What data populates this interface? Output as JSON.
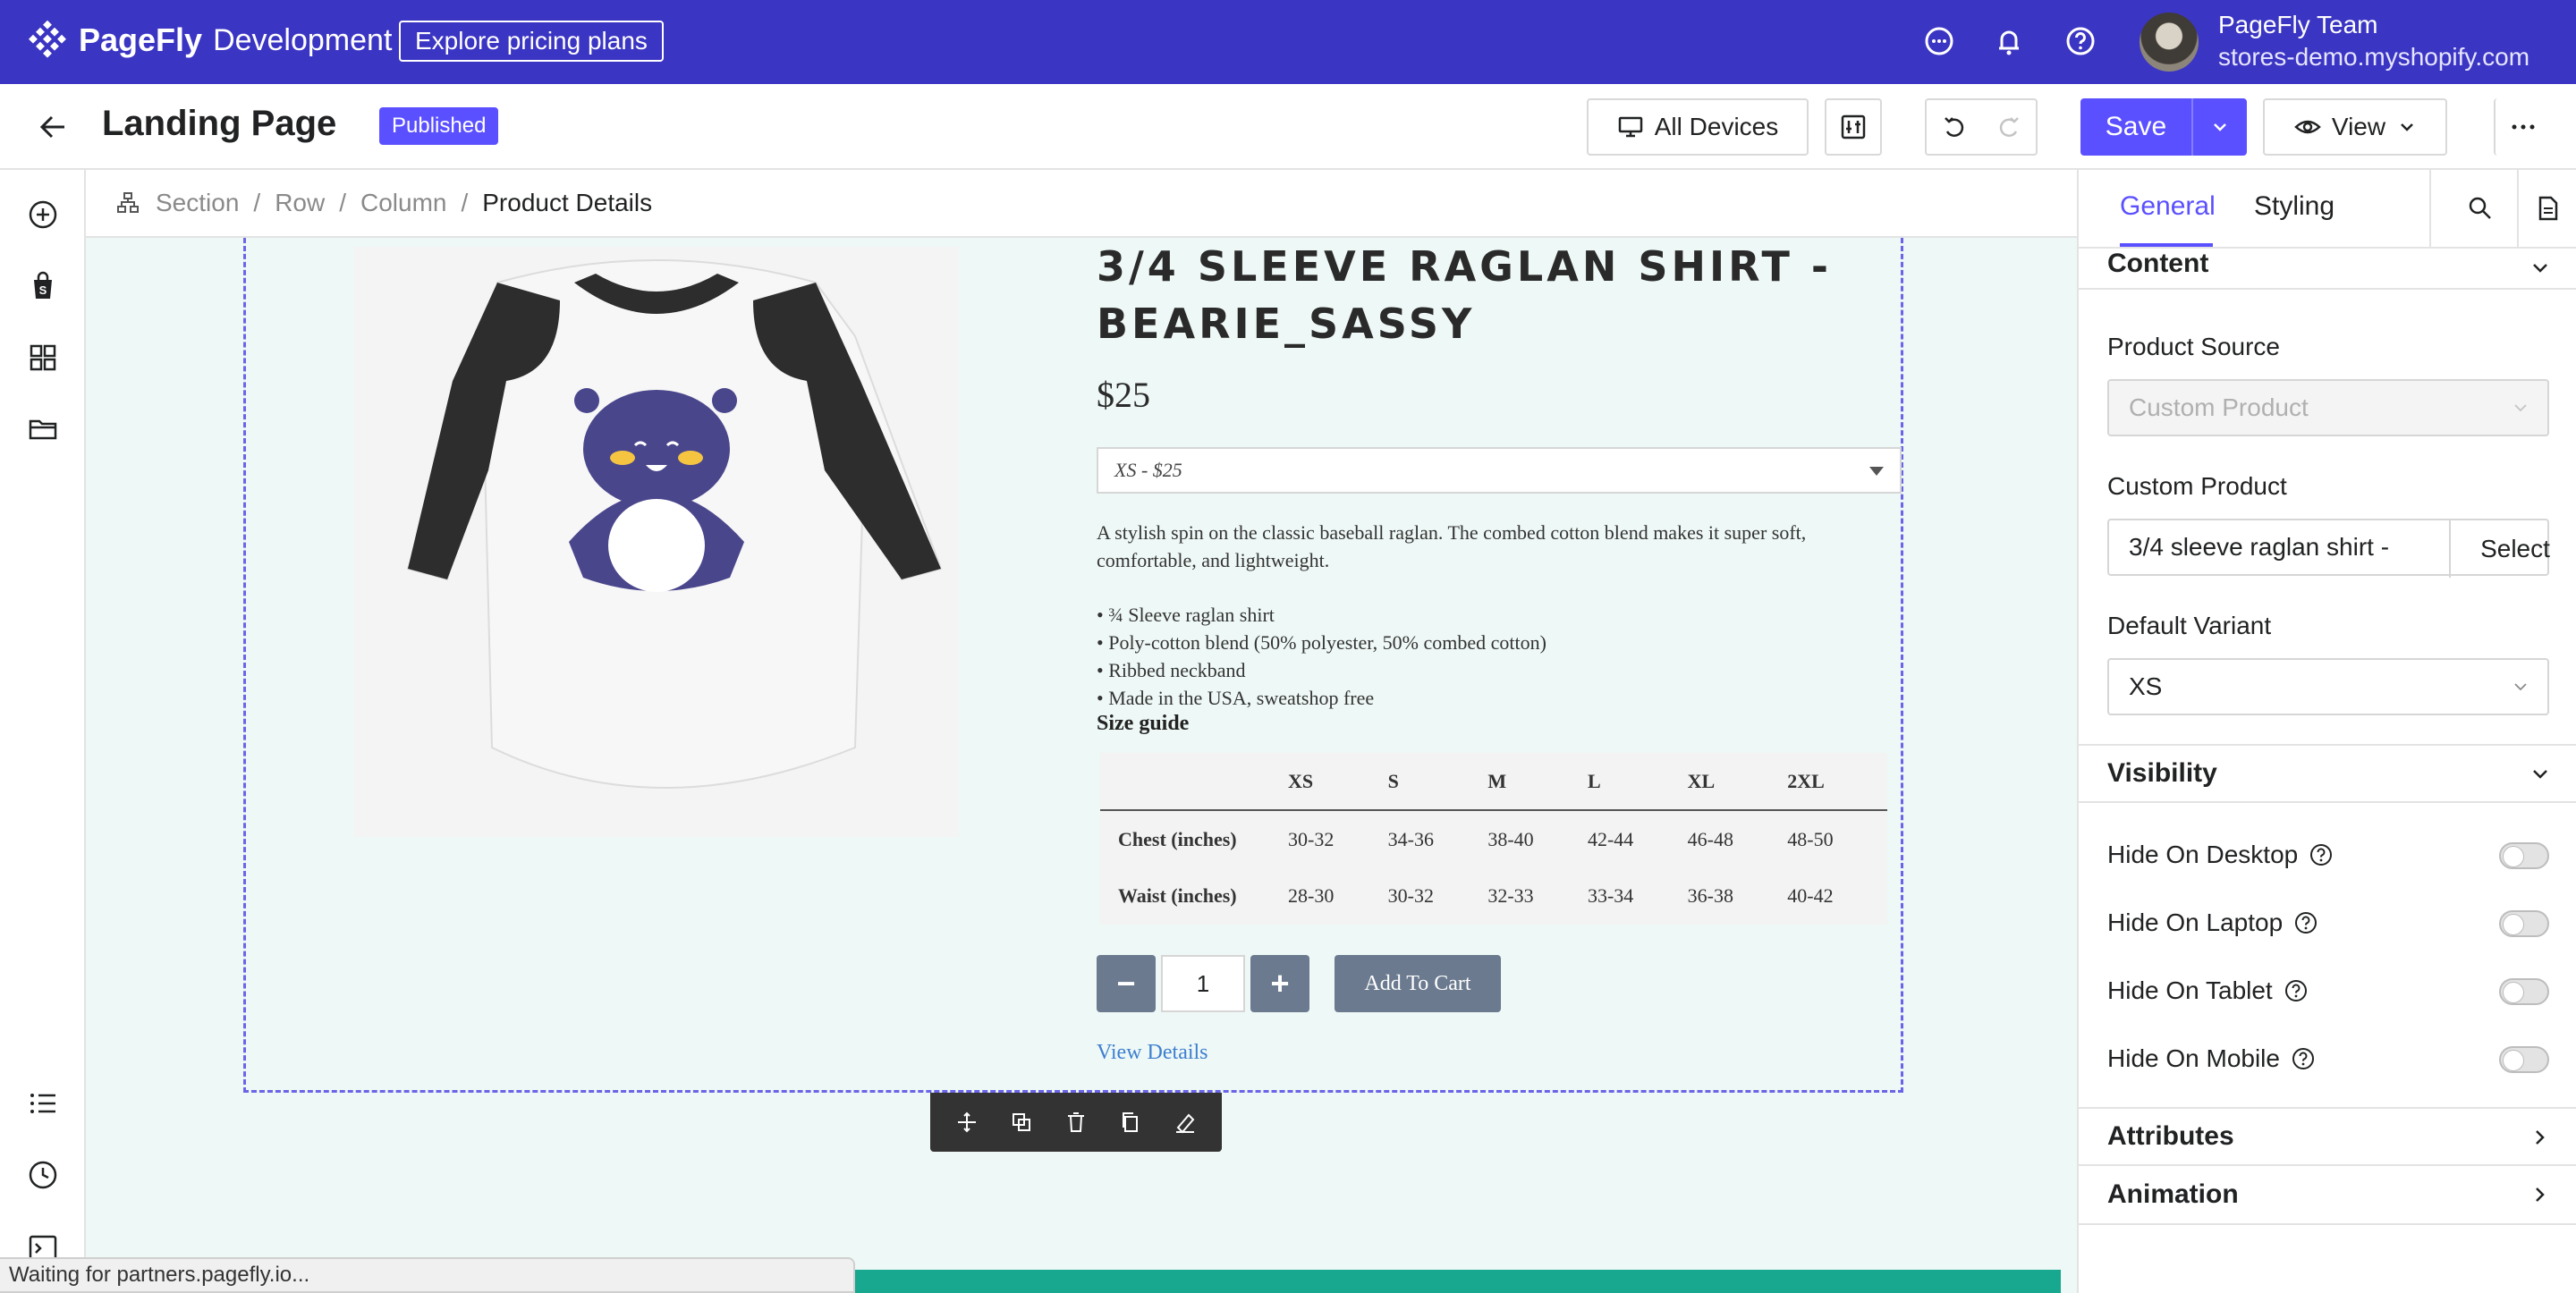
{
  "app": {
    "brand": "PageFly",
    "env": "Development",
    "pricing_button": "Explore pricing plans",
    "user_name": "PageFly Team",
    "user_store": "stores-demo.myshopify.com"
  },
  "header": {
    "title": "Landing Page",
    "badge": "Published",
    "devices_label": "All Devices",
    "save_label": "Save",
    "view_label": "View"
  },
  "breadcrumb": {
    "items": [
      "Section",
      "Row",
      "Column"
    ],
    "current": "Product Details"
  },
  "product": {
    "title": "3/4 SLEEVE RAGLAN SHIRT - BEARIE_SASSY",
    "price": "$25",
    "variant": "XS - $25",
    "description": "A stylish spin on the classic baseball raglan. The combed cotton blend makes it super soft, comfortable, and lightweight.",
    "bullets": [
      "• ¾ Sleeve raglan shirt",
      "• Poly-cotton blend (50% polyester, 50% combed cotton)",
      "• Ribbed neckband",
      "• Made in the USA, sweatshop free"
    ],
    "size_guide_label": "Size guide",
    "size_table": {
      "headers": [
        "",
        "XS",
        "S",
        "M",
        "L",
        "XL",
        "2XL"
      ],
      "rows": [
        [
          "Chest (inches)",
          "30-32",
          "34-36",
          "38-40",
          "42-44",
          "46-48",
          "48-50"
        ],
        [
          "Waist (inches)",
          "28-30",
          "30-32",
          "32-33",
          "33-34",
          "36-38",
          "40-42"
        ]
      ]
    },
    "quantity": "1",
    "minus": "−",
    "plus": "+",
    "add_to_cart": "Add To Cart",
    "view_details": "View Details"
  },
  "status_bar": "Waiting for partners.pagefly.io...",
  "right_panel": {
    "tabs": [
      "General",
      "Styling"
    ],
    "content_header": "Content",
    "product_source_label": "Product Source",
    "product_source_value": "Custom Product",
    "custom_product_label": "Custom Product",
    "custom_product_value": "3/4 sleeve raglan shirt -",
    "select_label": "Select",
    "default_variant_label": "Default Variant",
    "default_variant_value": "XS",
    "visibility_header": "Visibility",
    "toggles": [
      "Hide On Desktop",
      "Hide On Laptop",
      "Hide On Tablet",
      "Hide On Mobile"
    ],
    "attributes_header": "Attributes",
    "animation_header": "Animation"
  },
  "colors": {
    "brand_bar": "#3b35c3",
    "accent": "#5b50ff",
    "canvas_bg": "#eef8f6",
    "selection": "#6a64e8",
    "footer_band": "#17a88f"
  }
}
